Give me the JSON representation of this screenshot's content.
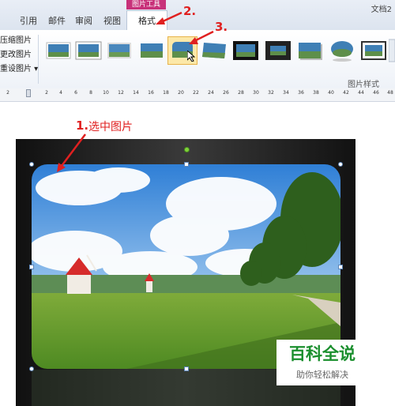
{
  "tabs": {
    "reference": "引用",
    "mail": "邮件",
    "review": "审阅",
    "view": "视图",
    "format": "格式"
  },
  "context_group": "图片工具",
  "doc_name": "文档2",
  "adjust": {
    "compress": "压缩图片",
    "change": "更改图片",
    "reset": "重设图片 ▾"
  },
  "styles_group_label": "图片样式",
  "ruler_ticks": [
    "2",
    "4",
    "6",
    "8",
    "10",
    "12",
    "14",
    "16",
    "18",
    "20",
    "22",
    "24",
    "26",
    "28",
    "30",
    "32",
    "34",
    "36",
    "38",
    "40",
    "42",
    "44",
    "46",
    "48"
  ],
  "annotations": {
    "step1_num": "1.",
    "step1_text": "选中图片",
    "step2": "2.",
    "step3": "3."
  },
  "watermark": {
    "title": "百科全说",
    "subtitle": "助你轻松解决"
  },
  "colors": {
    "annotation": "#e02020",
    "context_tab": "#c8327a",
    "watermark_green": "#1b8f2e"
  }
}
